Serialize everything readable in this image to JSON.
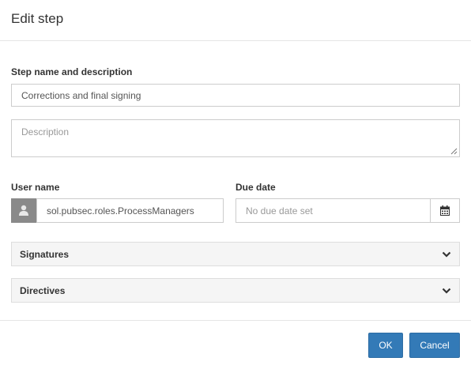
{
  "dialog": {
    "title": "Edit step"
  },
  "step": {
    "section_label": "Step name and description",
    "name_value": "Corrections and final signing",
    "description_placeholder": "Description"
  },
  "user": {
    "label": "User name",
    "value": "sol.pubsec.roles.ProcessManagers",
    "icon": "user-icon"
  },
  "due_date": {
    "label": "Due date",
    "placeholder": "No due date set",
    "icon": "calendar-icon"
  },
  "accordions": [
    {
      "label": "Signatures",
      "icon": "chevron-down-icon"
    },
    {
      "label": "Directives",
      "icon": "chevron-down-icon"
    }
  ],
  "footer": {
    "ok_label": "OK",
    "cancel_label": "Cancel"
  },
  "colors": {
    "primary": "#337ab7",
    "border": "#cccccc",
    "panel": "#f5f5f5"
  }
}
